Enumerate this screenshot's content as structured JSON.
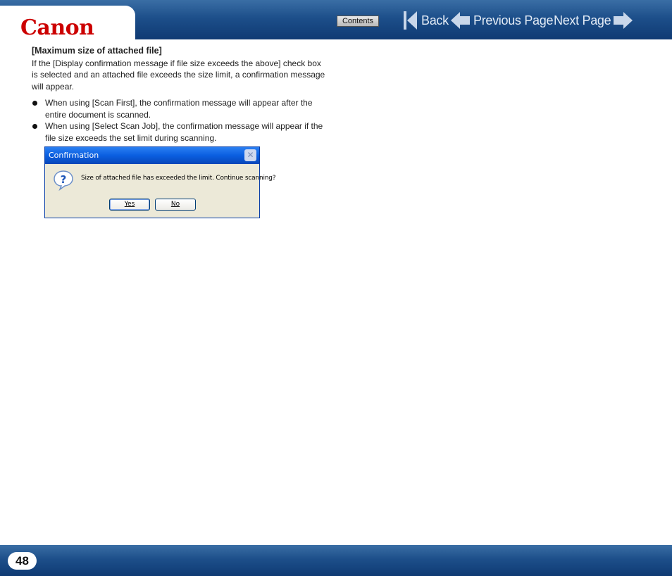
{
  "header": {
    "logo_text": "Canon",
    "contents_label": "Contents",
    "back_label": "Back",
    "prev_label": "Previous Page",
    "next_label": "Next Page",
    "icons": {
      "back": "skip-back-icon",
      "prev": "arrow-left-icon",
      "next": "arrow-right-icon"
    }
  },
  "content": {
    "heading": "[Maximum size of attached file]",
    "paragraph": "If the [Display confirmation message if file size exceeds the above] check box is selected and an attached file exceeds the size limit, a confirmation message will appear.",
    "bullets": [
      "When using [Scan First], the confirmation message will appear after the entire document is scanned.",
      "When using [Select Scan Job], the confirmation message will appear if the file size exceeds the set limit during scanning."
    ]
  },
  "dialog": {
    "title": "Confirmation",
    "message": "Size of attached file has exceeded the limit. Continue scanning?",
    "yes_label": "Yes",
    "no_label": "No",
    "icon": "question-icon"
  },
  "footer": {
    "page_number": "48"
  },
  "colors": {
    "brand_red": "#cc0000",
    "header_blue": "#1d4f8a"
  }
}
